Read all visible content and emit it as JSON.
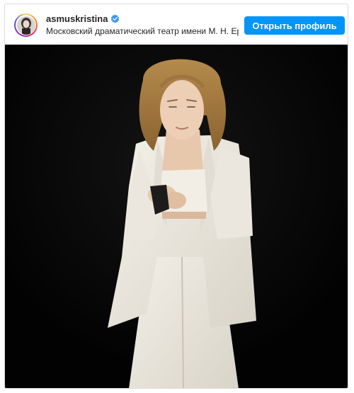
{
  "post": {
    "username": "asmuskristina",
    "location": "Московский драматический театр имени М. Н. Ер",
    "open_profile_label": "Открыть профиль"
  },
  "icons": {
    "verified": "verified-badge-icon",
    "avatar": "profile-avatar"
  },
  "colors": {
    "accent": "#0095f6",
    "text": "#262626",
    "border": "#dbdbdb",
    "photo_background": "#030303",
    "suit": "#efece4"
  }
}
